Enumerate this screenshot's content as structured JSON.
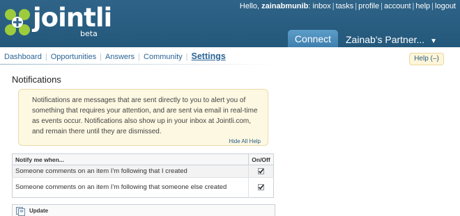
{
  "header": {
    "logo_text": "jointli",
    "logo_sub": "beta",
    "greeting": "Hello,",
    "username": "zainabmunib",
    "top_links": [
      "inbox",
      "tasks",
      "profile",
      "account",
      "help",
      "logout"
    ],
    "tab_connect": "Connect",
    "tab_partner": "Zainab's Partner...",
    "tab_partner_arrow": "▼"
  },
  "subnav": {
    "items": [
      "Dashboard",
      "Opportunities",
      "Answers",
      "Community"
    ],
    "active": "Settings"
  },
  "help_button": "Help (–)",
  "page_title": "Notifications",
  "info": {
    "text": "Notifications are messages that are sent directly to you to alert you of something that requires your attention, and are sent via email in real-time as events occur. Notifications also show up in your inbox at Jointli.com, and remain there until they are dismissed.",
    "hide_link": "Hide All Help"
  },
  "table": {
    "col_notify": "Notify me when...",
    "col_onoff": "On/Off",
    "rows": [
      {
        "label": "Someone comments on an item I'm following that I created",
        "checked": true
      },
      {
        "label": "Someone comments on an item I'm following that someone else created",
        "checked": true
      }
    ]
  },
  "update_label": "Update",
  "colors": {
    "header_bg": "#2a5f83",
    "tab_connect": "#4f8fbf",
    "link": "#2a6496",
    "info_bg": "#fdf8e2"
  }
}
